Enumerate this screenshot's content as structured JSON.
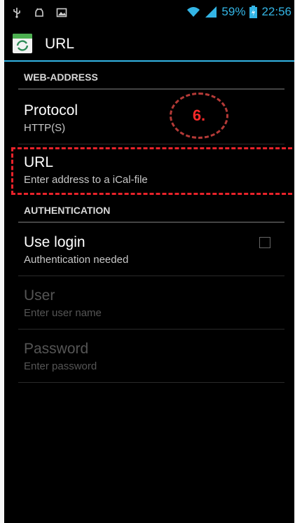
{
  "status_bar": {
    "left_icons": [
      "usb-icon",
      "android-debug-icon",
      "image-notification-icon"
    ],
    "right_icons": [
      "wifi-icon",
      "signal-icon",
      "battery-icon"
    ],
    "battery": "59%",
    "time": "22:56",
    "accent": "#33b5e5"
  },
  "action_bar": {
    "icon": "calendar-sync-icon",
    "title": "URL"
  },
  "sections": {
    "web_address": "WEB-ADDRESS",
    "authentication": "AUTHENTICATION"
  },
  "prefs": {
    "protocol": {
      "title": "Protocol",
      "summary": "HTTP(S)"
    },
    "url": {
      "title": "URL",
      "summary": "Enter address to a iCal-file"
    },
    "use_login": {
      "title": "Use login",
      "summary": "Authentication needed",
      "checked": false
    },
    "user": {
      "title": "User",
      "summary": "Enter user name",
      "enabled": false
    },
    "password": {
      "title": "Password",
      "summary": "Enter password",
      "enabled": false
    }
  },
  "annotation": {
    "step_label": "6.",
    "color": "#e8222a"
  }
}
